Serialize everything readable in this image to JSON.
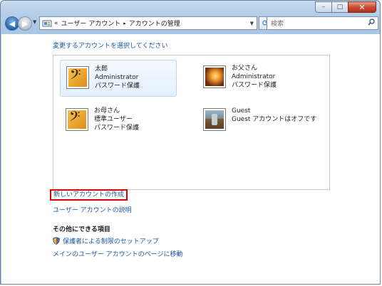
{
  "window": {
    "caption_buttons": {
      "minimize": "–",
      "maximize": "□",
      "close": "✕"
    }
  },
  "navigation": {
    "address_segments": [
      "«",
      "ユーザー アカウント",
      "▸",
      "アカウントの管理"
    ],
    "search_placeholder": "検索",
    "icons": [
      "back-arrow-icon",
      "forward-arrow-icon",
      "control-panel-icon",
      "refresh-icon",
      "search-icon"
    ]
  },
  "content": {
    "heading": "変更するアカウントを選択してください",
    "accounts": [
      {
        "name": "太郎",
        "type": "Administrator",
        "status": "パスワード保護",
        "picture": "music-clef",
        "selected": true
      },
      {
        "name": "お父さん",
        "type": "Administrator",
        "status": "パスワード保護",
        "picture": "lights",
        "selected": false
      },
      {
        "name": "お母さん",
        "type": "標準ユーザー",
        "status": "パスワード保護",
        "picture": "music-clef",
        "selected": false
      },
      {
        "name": "Guest",
        "type": "Guest アカウントはオフです",
        "status": "",
        "picture": "chair",
        "selected": false
      }
    ],
    "create_account_link": "新しいアカウントの作成",
    "explain_link": "ユーザー アカウントの説明",
    "other_tasks_heading": "その他にできる項目",
    "tasks": [
      {
        "label": "保護者による制限のセットアップ",
        "icon": "shield-icon"
      },
      {
        "label": "メインのユーザー アカウントのページに移動"
      }
    ]
  },
  "colors": {
    "link": "#1a59a8",
    "highlight_border": "#e00000",
    "chrome": "#b7d0ea"
  }
}
